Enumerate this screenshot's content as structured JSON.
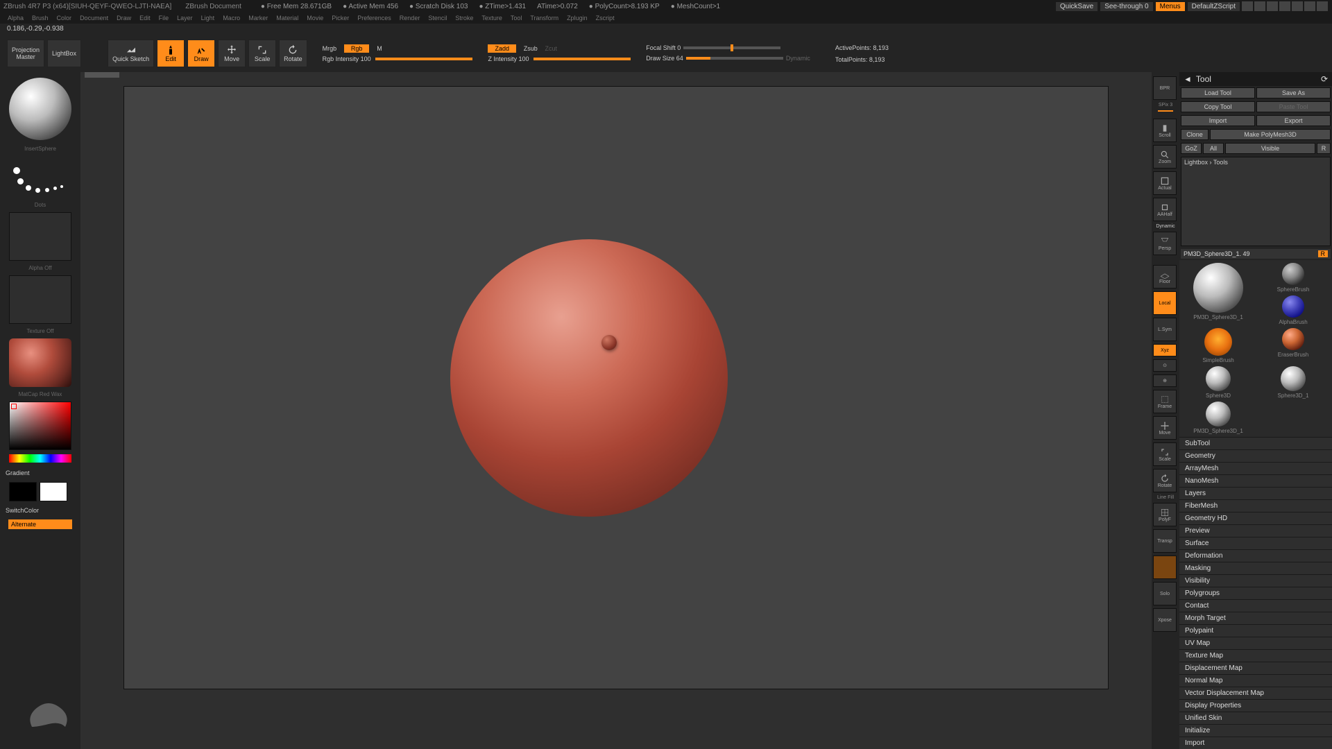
{
  "title_bar": {
    "app": "ZBrush 4R7 P3 (x64)[SIUH-QEYF-QWEO-LJTI-NAEA]",
    "doc": "ZBrush Document",
    "free_mem": "Free Mem 28.671GB",
    "active_mem": "Active Mem 456",
    "scratch": "Scratch Disk 103",
    "ztime": "ZTime>1.431",
    "atime": "ATime>0.072",
    "polycount": "PolyCount>8.193 KP",
    "meshcount": "MeshCount>1",
    "quicksave": "QuickSave",
    "seethrough": "See-through  0",
    "menus": "Menus",
    "script": "DefaultZScript"
  },
  "menu": [
    "Alpha",
    "Brush",
    "Color",
    "Document",
    "Draw",
    "Edit",
    "File",
    "Layer",
    "Light",
    "Macro",
    "Marker",
    "Material",
    "Movie",
    "Picker",
    "Preferences",
    "Render",
    "Stencil",
    "Stroke",
    "Texture",
    "Tool",
    "Transform",
    "Zplugin",
    "Zscript"
  ],
  "coords": "0.186,-0.29,-0.938",
  "toolbar": {
    "projection": "Projection\nMaster",
    "lightbox": "LightBox",
    "quicksketch": "Quick Sketch",
    "edit": "Edit",
    "draw": "Draw",
    "move": "Move",
    "scale": "Scale",
    "rotate": "Rotate",
    "mrgb": "Mrgb",
    "rgb": "Rgb",
    "m": "M",
    "rgb_intensity": "Rgb Intensity 100",
    "zadd": "Zadd",
    "zsub": "Zsub",
    "zcut": "Zcut",
    "z_intensity": "Z Intensity 100",
    "focal_shift": "Focal Shift 0",
    "draw_size": "Draw Size 64",
    "dynamic": "Dynamic",
    "active_points": "ActivePoints: 8,193",
    "total_points": "TotalPoints: 8,193"
  },
  "left": {
    "insert_sphere": "InsertSphere",
    "dots": "Dots",
    "alpha_off": "Alpha Off",
    "texture_off": "Texture Off",
    "matcap": "MatCap Red Wax",
    "gradient": "Gradient",
    "switchcolor": "SwitchColor",
    "alternate": "Alternate"
  },
  "nav": {
    "spix": "SPix 3",
    "bpr": "BPR",
    "scroll": "Scroll",
    "zoom": "Zoom",
    "actual": "Actual",
    "aahalf": "AAHalf",
    "persp": "Persp",
    "floor": "Floor",
    "local": "Local",
    "lsym": "L.Sym",
    "xyz": "Xyz",
    "frame": "Frame",
    "move": "Move",
    "scale": "Scale",
    "rotate": "Rotate",
    "polyf": "PolyF",
    "transp": "Transp",
    "dynamic": "Dynamic",
    "solo": "Solo",
    "xpose": "Xpose",
    "linefill": "Line Fill"
  },
  "tool_panel": {
    "header": "Tool",
    "load_tool": "Load Tool",
    "save_as": "Save As",
    "copy_tool": "Copy Tool",
    "paste_tool": "Paste Tool",
    "import": "Import",
    "export": "Export",
    "clone": "Clone",
    "make_polymesh": "Make PolyMesh3D",
    "goz": "GoZ",
    "all": "All",
    "visible": "Visible",
    "r": "R",
    "lightbox_tools": "Lightbox › Tools",
    "tool_name": "PM3D_Sphere3D_1. 49",
    "tools": {
      "pm3d": "PM3D_Sphere3D_1",
      "spherebrush": "SphereBrush",
      "alphabrush": "AlphaBrush",
      "simplebrush": "SimpleBrush",
      "eraserbrush": "EraserBrush",
      "sphere3d": "Sphere3D",
      "sphere3d1": "Sphere3D_1",
      "pm3d_s": "PM3D_Sphere3D_1"
    },
    "sections": [
      "SubTool",
      "Geometry",
      "ArrayMesh",
      "NanoMesh",
      "Layers",
      "FiberMesh",
      "Geometry HD",
      "Preview",
      "Surface",
      "Deformation",
      "Masking",
      "Visibility",
      "Polygroups",
      "Contact",
      "Morph Target",
      "Polypaint",
      "UV Map",
      "Texture Map",
      "Displacement Map",
      "Normal Map",
      "Vector Displacement Map",
      "Display Properties",
      "Unified Skin",
      "Initialize",
      "Import"
    ]
  }
}
